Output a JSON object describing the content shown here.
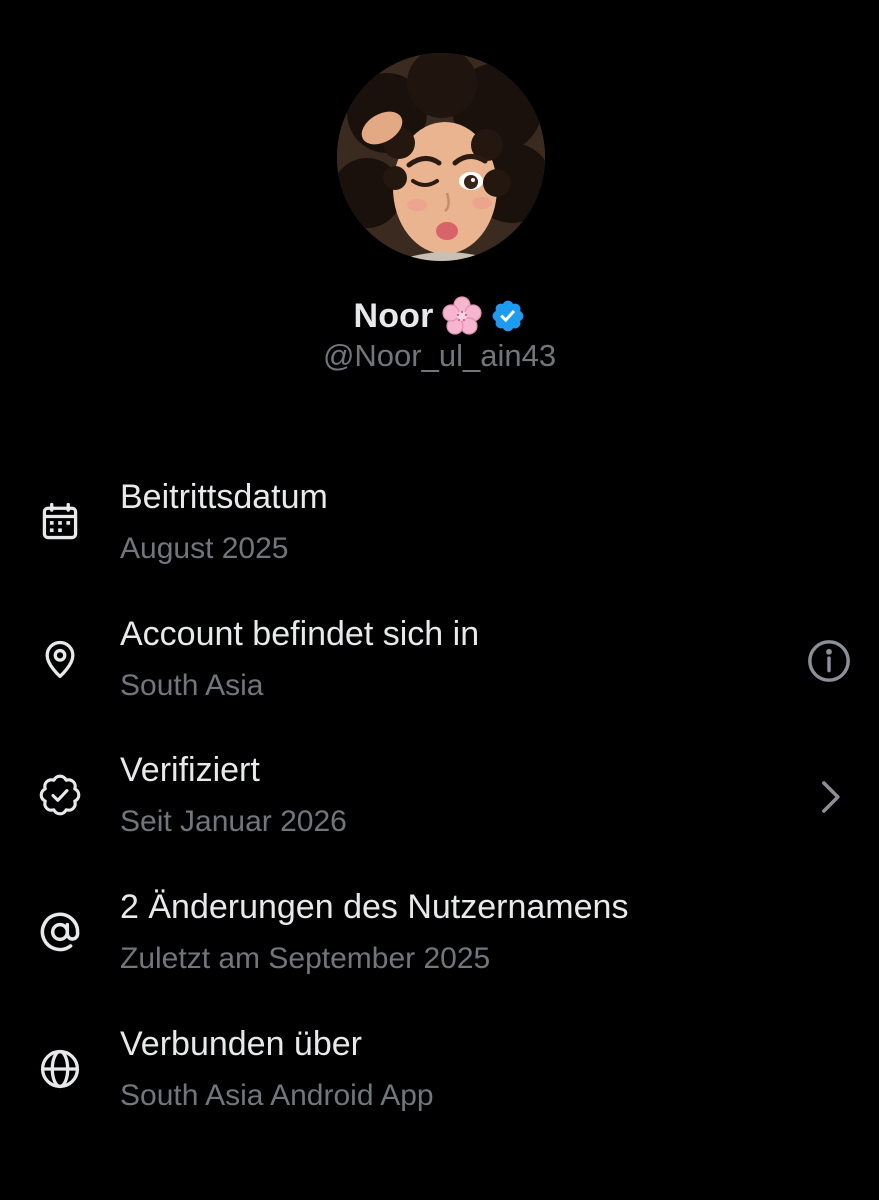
{
  "profile": {
    "display_name": "Noor",
    "name_emoji_icon": "cherry-blossom-icon",
    "verified_badge_icon": "verified-badge-icon",
    "handle": "@Noor_ul_ain43"
  },
  "colors": {
    "background": "#000000",
    "primary_text": "#e7e9ea",
    "secondary_text": "#71767b",
    "verified_blue": "#1d9bf0",
    "flower_pink": "#f4a9c8"
  },
  "about_rows": [
    {
      "icon": "calendar-icon",
      "title": "Beitrittsdatum",
      "subtitle": "August 2025",
      "trailing_icon": ""
    },
    {
      "icon": "location-pin-icon",
      "title": "Account befindet sich in",
      "subtitle": "South Asia",
      "trailing_icon": "info-icon"
    },
    {
      "icon": "verified-badge-outline-icon",
      "title": "Verifiziert",
      "subtitle": "Seit Januar 2026",
      "trailing_icon": "chevron-right-icon"
    },
    {
      "icon": "at-sign-icon",
      "title": "2 Änderungen des Nutzernamens",
      "subtitle": "Zuletzt am September 2025",
      "trailing_icon": ""
    },
    {
      "icon": "globe-icon",
      "title": "Verbunden über",
      "subtitle": "South Asia Android App",
      "trailing_icon": ""
    }
  ]
}
